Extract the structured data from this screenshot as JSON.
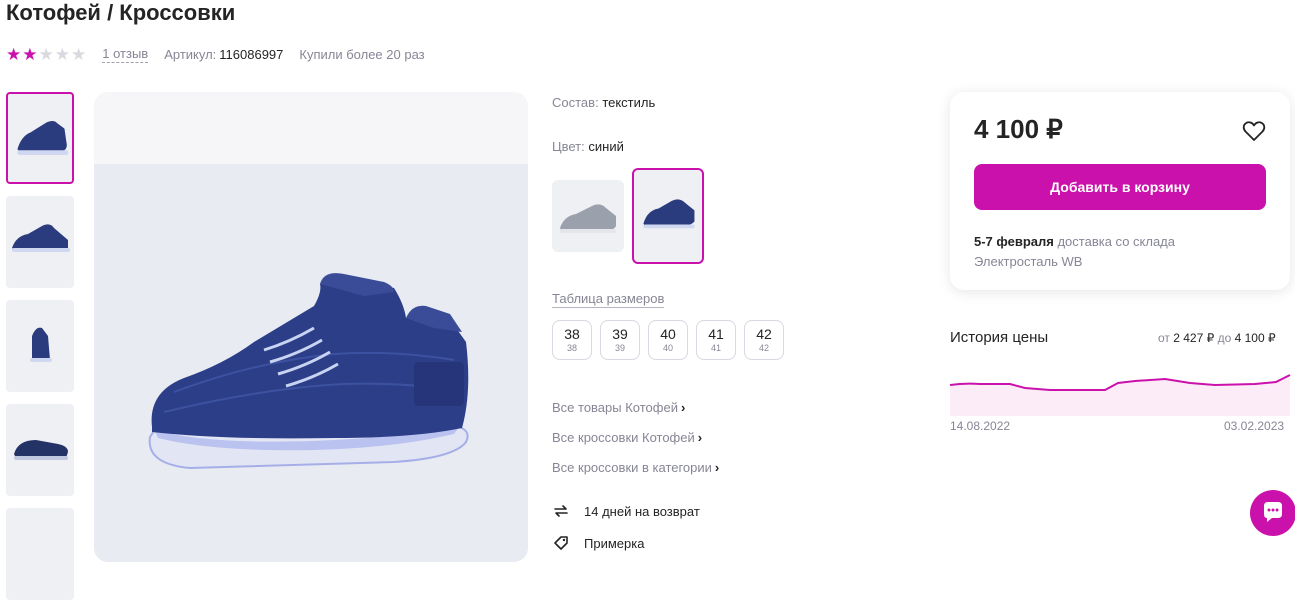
{
  "product": {
    "title": "Котофей / Кроссовки",
    "rating": 2,
    "rating_max": 5,
    "reviews": "1 отзыв",
    "article_label": "Артикул:",
    "article_value": "116086997",
    "bought": "Купили более 20 раз"
  },
  "details": {
    "composition_label": "Состав:",
    "composition_value": "текстиль",
    "color_label": "Цвет:",
    "color_value": "синий",
    "size_table": "Таблица размеров",
    "sizes": [
      {
        "main": "38",
        "sub": "38"
      },
      {
        "main": "39",
        "sub": "39"
      },
      {
        "main": "40",
        "sub": "40"
      },
      {
        "main": "41",
        "sub": "41"
      },
      {
        "main": "42",
        "sub": "42"
      }
    ],
    "links": [
      "Все товары Котофей",
      "Все кроссовки Котофей",
      "Все кроссовки в категории"
    ],
    "features": [
      "14 дней на возврат",
      "Примерка"
    ]
  },
  "purchase": {
    "price": "4 100 ₽",
    "cart_button": "Добавить в корзину",
    "delivery_date": "5-7 февраля",
    "delivery_text": "доставка со склада",
    "warehouse": "Электросталь WB"
  },
  "price_history": {
    "title": "История цены",
    "from_label": "от",
    "min": "2 427 ₽",
    "to_label": "до",
    "max": "4 100 ₽",
    "start_date": "14.08.2022",
    "end_date": "03.02.2023"
  },
  "icons": {
    "heart": "heart-icon",
    "return": "return-arrows-icon",
    "tag": "tag-icon",
    "chat": "chat-icon",
    "chevron": "chevron-right-icon"
  },
  "colors": {
    "accent": "#cb11ab",
    "text": "#242424",
    "muted": "#868695"
  }
}
